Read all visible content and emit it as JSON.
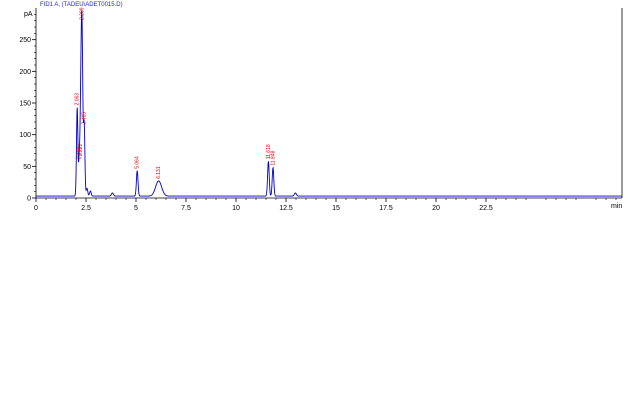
{
  "chart_data": {
    "type": "line",
    "title": "FID1 A, (TADEU\\ADET0015.D)",
    "ylabel": "pA",
    "xlabel": "min",
    "xlim": [
      0,
      29.3
    ],
    "ylim": [
      0,
      300
    ],
    "x_ticks": [
      0,
      2.5,
      5,
      7.5,
      10,
      12.5,
      15,
      17.5,
      20,
      22.5
    ],
    "x_tick_labels": [
      "0",
      "2.5",
      "5",
      "7.5",
      "10",
      "12.5",
      "15",
      "17.5",
      "20",
      "22.5"
    ],
    "y_ticks": [
      0,
      50,
      100,
      150,
      200,
      250
    ],
    "y_tick_labels": [
      "0",
      "50",
      "100",
      "150",
      "200",
      "250"
    ],
    "grid": false,
    "baseline": 3,
    "series": [
      {
        "color": "#0000c8",
        "peaks": [
          {
            "rt": 2.06,
            "height": 140,
            "width": 0.035,
            "label": "2.063"
          },
          {
            "rt": 2.16,
            "height": 55,
            "width": 0.03,
            "label": "2.163"
          },
          {
            "rt": 2.22,
            "height": 60,
            "width": 0.03,
            "label": "2.222"
          },
          {
            "rt": 2.29,
            "height": 290,
            "width": 0.045,
            "label": "2.299"
          },
          {
            "rt": 2.41,
            "height": 110,
            "width": 0.035,
            "label": "2.415"
          },
          {
            "rt": 2.55,
            "height": 12,
            "width": 0.04,
            "label": ""
          },
          {
            "rt": 2.72,
            "height": 8,
            "width": 0.04,
            "label": ""
          },
          {
            "rt": 3.82,
            "height": 5,
            "width": 0.05,
            "label": ""
          },
          {
            "rt": 5.06,
            "height": 40,
            "width": 0.04,
            "label": "5.064"
          },
          {
            "rt": 6.13,
            "height": 24,
            "width": 0.15,
            "label": "6.131"
          },
          {
            "rt": 11.62,
            "height": 55,
            "width": 0.04,
            "label": "11.618"
          },
          {
            "rt": 11.85,
            "height": 45,
            "width": 0.04,
            "label": "11.848"
          },
          {
            "rt": 12.97,
            "height": 5,
            "width": 0.05,
            "label": ""
          }
        ]
      }
    ]
  }
}
